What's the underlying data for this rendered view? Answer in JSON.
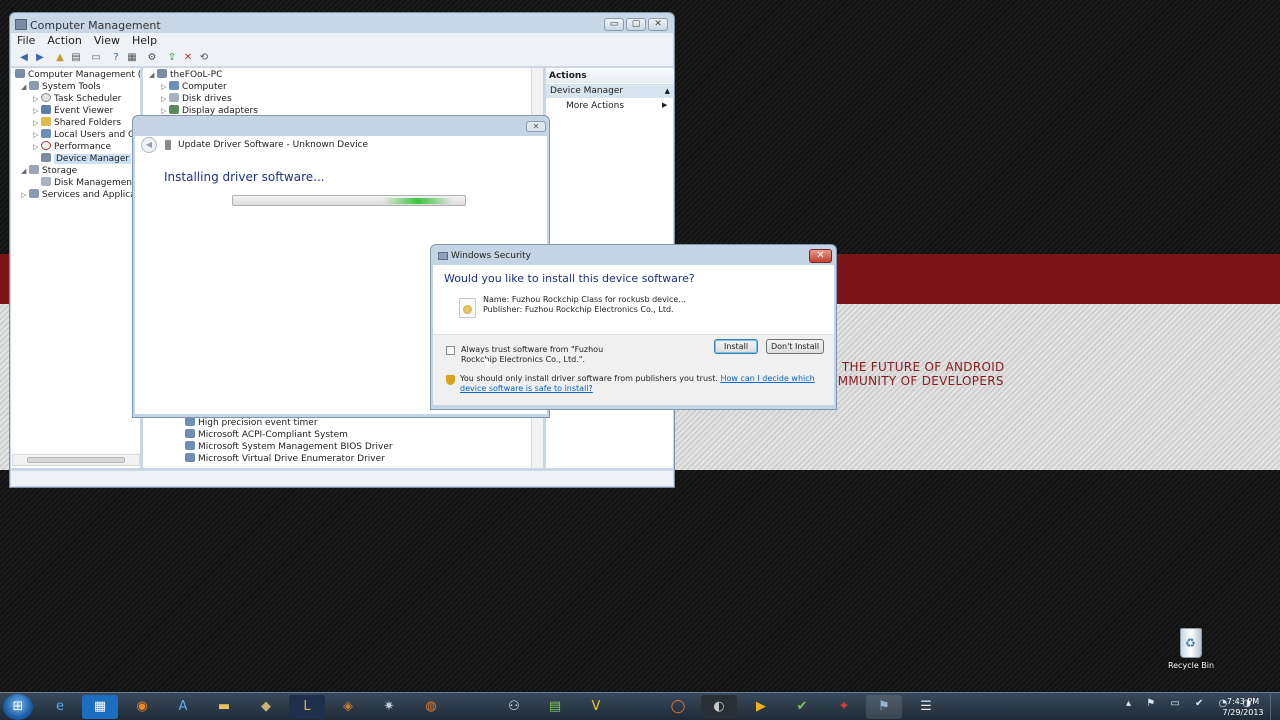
{
  "wallpaper": {
    "line1": "O THE FUTURE OF ANDROID",
    "line2": "OMMUNITY OF DEVELOPERS"
  },
  "computer_management": {
    "title": "Computer Management",
    "caption": {
      "minimize": "▭",
      "maximize": "▢",
      "close": "✕"
    },
    "menu": [
      "File",
      "Action",
      "View",
      "Help"
    ],
    "tree": [
      {
        "label": "Computer Management (Local",
        "level": 0,
        "arrow": ""
      },
      {
        "label": "System Tools",
        "level": 1,
        "arrow": "◢"
      },
      {
        "label": "Task Scheduler",
        "level": 2,
        "arrow": "▷"
      },
      {
        "label": "Event Viewer",
        "level": 2,
        "arrow": "▷"
      },
      {
        "label": "Shared Folders",
        "level": 2,
        "arrow": "▷"
      },
      {
        "label": "Local Users and Group",
        "level": 2,
        "arrow": "▷"
      },
      {
        "label": "Performance",
        "level": 2,
        "arrow": "▷"
      },
      {
        "label": "Device Manager",
        "level": 2,
        "arrow": ""
      },
      {
        "label": "Storage",
        "level": 1,
        "arrow": "◢"
      },
      {
        "label": "Disk Management",
        "level": 2,
        "arrow": ""
      },
      {
        "label": "Services and Applications",
        "level": 1,
        "arrow": "▷"
      }
    ],
    "devices_top": [
      {
        "label": "theFOoL-PC",
        "arrow": "◢"
      },
      {
        "label": "Computer",
        "arrow": "▷"
      },
      {
        "label": "Disk drives",
        "arrow": "▷"
      },
      {
        "label": "Display adapters",
        "arrow": "▷"
      }
    ],
    "devices_bottom": [
      "High precision event timer",
      "Microsoft ACPI-Compliant System",
      "Microsoft System Management BIOS Driver",
      "Microsoft Virtual Drive Enumerator Driver"
    ],
    "actions": {
      "header": "Actions",
      "section": "Device Manager",
      "more": "More Actions"
    }
  },
  "update_driver": {
    "title": "Update Driver Software - Unknown Device",
    "heading": "Installing driver software...",
    "close": "✕"
  },
  "windows_security": {
    "title": "Windows Security",
    "close": "✕",
    "question": "Would you like to install this device software?",
    "name": "Name: Fuzhou Rockchip Class for rockusb device...",
    "publisher": "Publisher: Fuzhou Rockchip Electronics Co., Ltd.",
    "always_trust": "Always trust software from \"Fuzhou Rockchip Electronics Co., Ltd.\".",
    "install_label": "Install",
    "dont_install_label": "Don't Install",
    "warning_text": "You should only install driver software from publishers you trust.",
    "help_link": "How can I decide which device software is safe to install?"
  },
  "desktop": {
    "recycle_bin": "Recycle Bin"
  },
  "taskbar": {
    "start_glyph": "⊞",
    "apps": [
      "e",
      "▦",
      "◉",
      "A",
      "▬",
      "◆",
      "L",
      "◈",
      "✷",
      "◍",
      "⚇",
      "▤",
      "V",
      "◯",
      "◐",
      "▶",
      "✔",
      "✦",
      "⚑",
      "☰"
    ],
    "tray_icons": "▴ ⚑ ▭ ✔ ◔ ◑",
    "time": "7:43 PM",
    "date": "7/29/2013"
  }
}
